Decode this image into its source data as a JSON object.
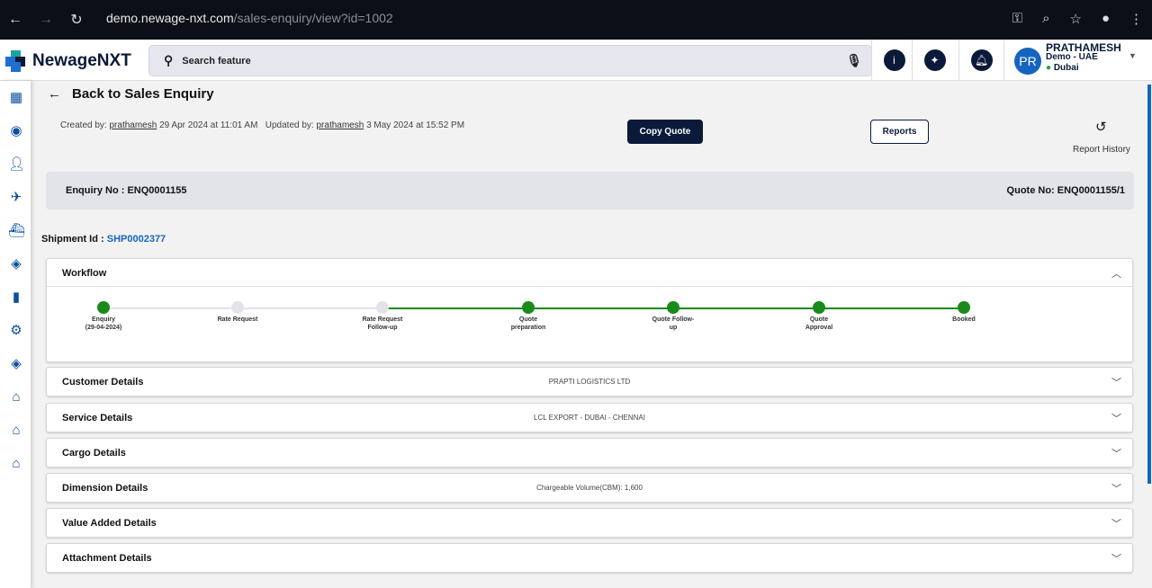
{
  "browser": {
    "url_host": "demo.newage-nxt.com",
    "url_path": "/sales-enquiry/view?id=1002"
  },
  "header": {
    "logo": "NewageNXT",
    "search_placeholder": "Search feature",
    "user": {
      "initials": "PR",
      "name": "PRATHAMESH",
      "org": "Demo - UAE",
      "location": "Dubai"
    }
  },
  "page": {
    "back_label": "Back to Sales Enquiry",
    "created_label": "Created by:",
    "created_by": "prathamesh",
    "created_at": "29 Apr 2024 at 11:01 AM",
    "updated_label": "Updated by:",
    "updated_by": "prathamesh",
    "updated_at": "3 May 2024 at 15:52 PM",
    "copy_quote": "Copy Quote",
    "reports": "Reports",
    "report_history": "Report History",
    "enquiry_no": "Enquiry No : ENQ0001155",
    "quote_no": "Quote No: ENQ0001155/1",
    "shipment_label": "Shipment Id :",
    "shipment_id": "SHP0002377"
  },
  "workflow": {
    "title": "Workflow",
    "steps": [
      {
        "l1": "Enquiry",
        "l2": "(29-04-2024)",
        "done": true
      },
      {
        "l1": "Rate Request",
        "l2": "",
        "done": false
      },
      {
        "l1": "Rate Request",
        "l2": "Follow-up",
        "done": false
      },
      {
        "l1": "Quote",
        "l2": "preparation",
        "done": true
      },
      {
        "l1": "Quote Follow-",
        "l2": "up",
        "done": true
      },
      {
        "l1": "Quote",
        "l2": "Approval",
        "done": true
      },
      {
        "l1": "Booked",
        "l2": "",
        "done": true
      }
    ],
    "colors": {
      "done": "#1a8a1a",
      "pending": "#e2e3ea"
    }
  },
  "sections": [
    {
      "title": "Customer Details",
      "summary": "PRAPTI LOGISTICS LTD"
    },
    {
      "title": "Service Details",
      "summary": "LCL EXPORT - DUBAI - CHENNAI"
    },
    {
      "title": "Cargo Details",
      "summary": ""
    },
    {
      "title": "Dimension Details",
      "summary": "Chargeable Volume(CBM): 1,600"
    },
    {
      "title": "Value Added Details",
      "summary": ""
    },
    {
      "title": "Attachment Details",
      "summary": ""
    }
  ]
}
